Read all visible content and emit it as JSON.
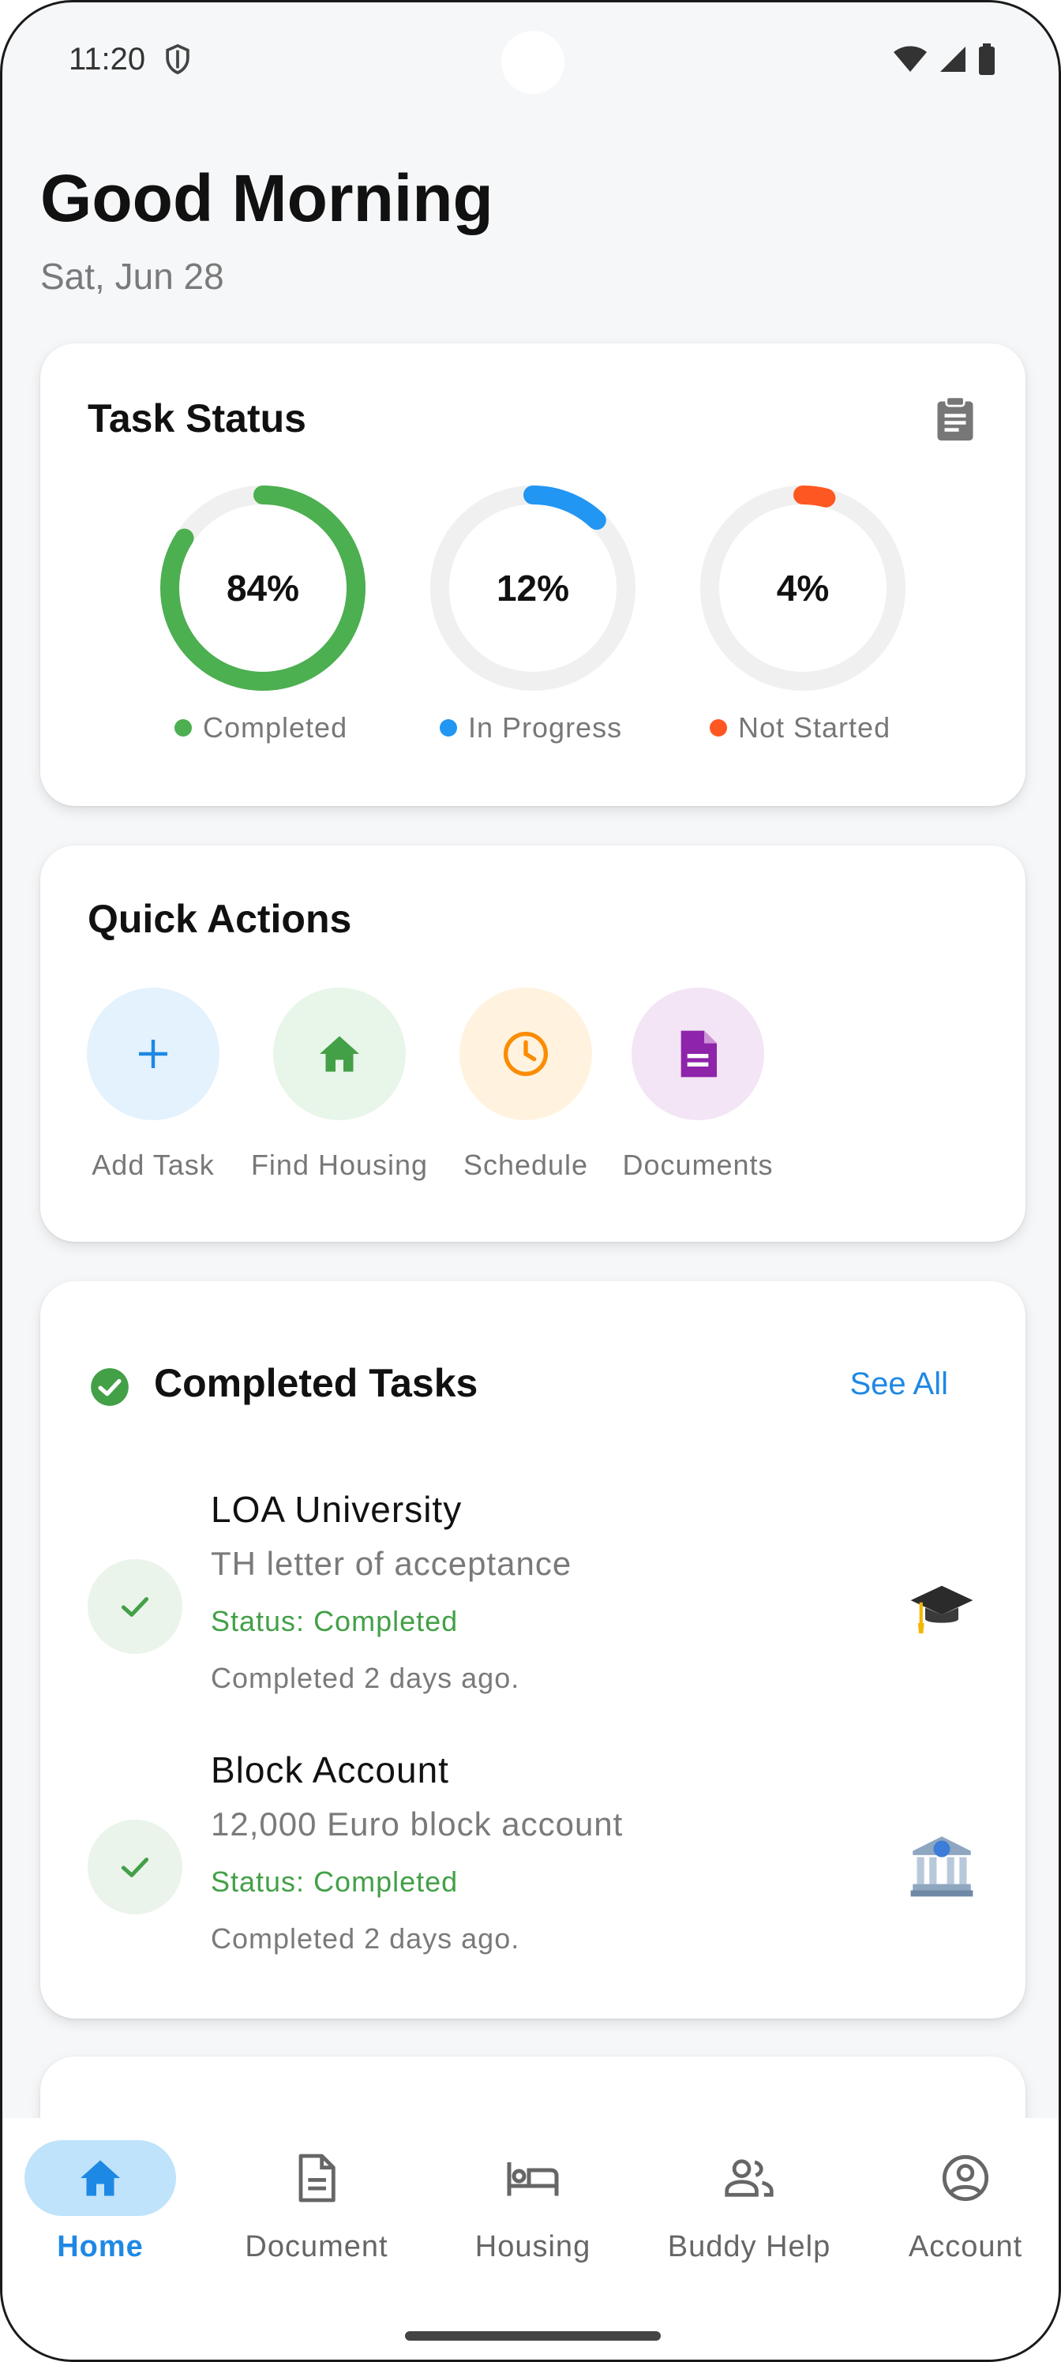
{
  "status_bar": {
    "time": "11:20"
  },
  "greeting": "Good Morning",
  "date": "Sat, Jun 28",
  "task_status": {
    "title": "Task Status",
    "rings": [
      {
        "value": "84%",
        "fraction": 0.84,
        "label": "Completed",
        "color": "#4caf50"
      },
      {
        "value": "12%",
        "fraction": 0.12,
        "label": "In Progress",
        "color": "#2196f3"
      },
      {
        "value": "4%",
        "fraction": 0.04,
        "label": "Not Started",
        "color": "#ff5722"
      }
    ],
    "track_color": "#f0f0f0"
  },
  "quick_actions": {
    "title": "Quick Actions",
    "items": [
      {
        "label": "Add Task",
        "icon": "plus-icon",
        "bg": "#e3f2fd",
        "fg": "#1e88e5"
      },
      {
        "label": "Find Housing",
        "icon": "home-icon",
        "bg": "#e8f5e9",
        "fg": "#43a047"
      },
      {
        "label": "Schedule",
        "icon": "clock-icon",
        "bg": "#fff3e0",
        "fg": "#fb8c00"
      },
      {
        "label": "Documents",
        "icon": "document-icon",
        "bg": "#f3e5f5",
        "fg": "#8e24aa"
      }
    ]
  },
  "completed_tasks": {
    "title": "Completed Tasks",
    "see_all": "See All",
    "items": [
      {
        "title": "LOA University",
        "subtitle": "TH letter of acceptance",
        "status": "Status: Completed",
        "time": "Completed 2 days ago.",
        "icon": "graduation-cap-icon"
      },
      {
        "title": "Block Account",
        "subtitle": "12,000 Euro block account",
        "status": "Status: Completed",
        "time": "Completed 2 days ago.",
        "icon": "bank-icon"
      }
    ]
  },
  "bottom_nav": {
    "active": "Home",
    "active_color": "#1e88e5",
    "active_bg": "#bfe3fb",
    "items": [
      {
        "label": "Home",
        "icon": "home-icon"
      },
      {
        "label": "Document",
        "icon": "document-icon"
      },
      {
        "label": "Housing",
        "icon": "bed-icon"
      },
      {
        "label": "Buddy Help",
        "icon": "people-icon"
      },
      {
        "label": "Account",
        "icon": "account-circle-icon"
      }
    ]
  }
}
